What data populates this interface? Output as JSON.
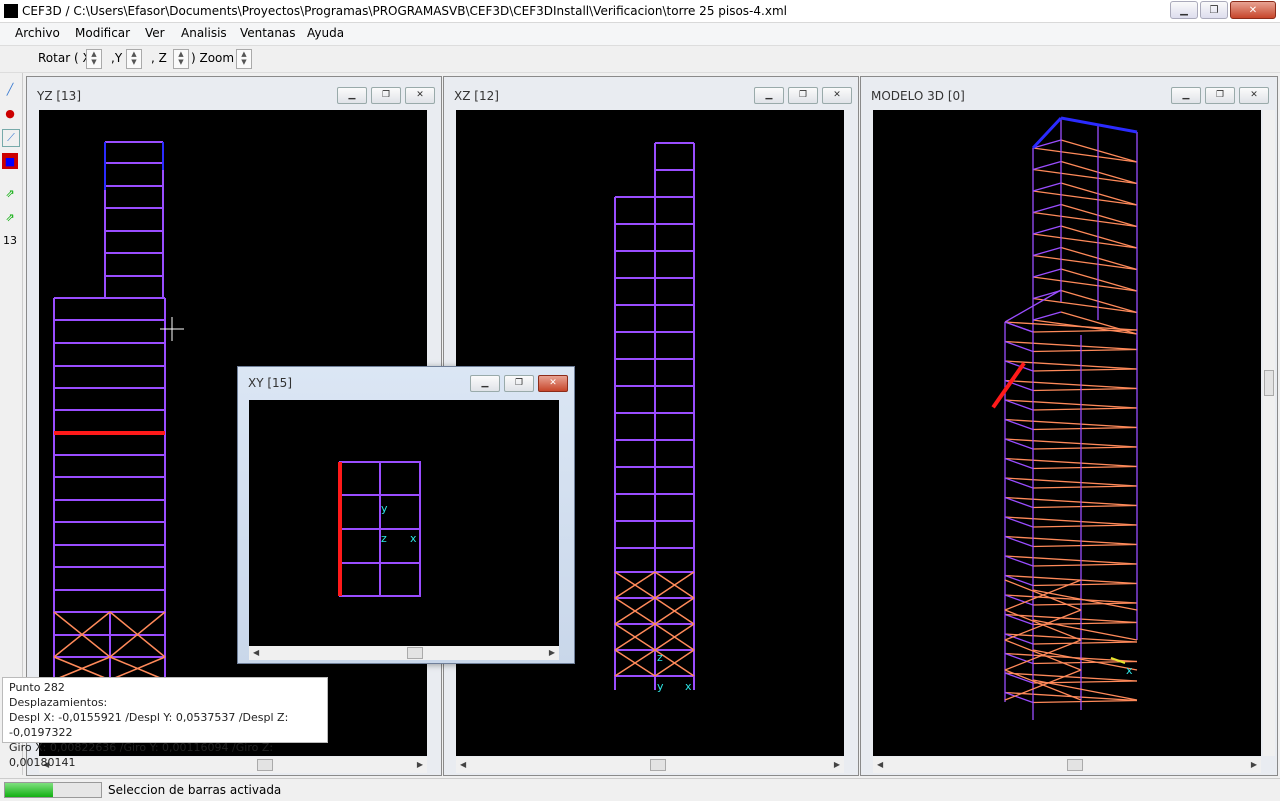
{
  "app": {
    "title": "CEF3D / C:\\Users\\Efasor\\Documents\\Proyectos\\Programas\\PROGRAMASVB\\CEF3D\\CEF3DInstall\\Verificacion\\torre 25 pisos-4.xml"
  },
  "menu": [
    "Archivo",
    "Modificar",
    "Ver",
    "Analisis",
    "Ventanas",
    "Ayuda"
  ],
  "toolbar": {
    "rotar_label": "Rotar ( X",
    "y_label": ",Y",
    "z_label": ", Z",
    "zoom_label": ") Zoom"
  },
  "left_tools": {
    "number": "13"
  },
  "windows": {
    "yz": {
      "title": "YZ [13]"
    },
    "xz": {
      "title": "XZ [12]"
    },
    "modelo": {
      "title": "MODELO 3D [0]"
    },
    "xy": {
      "title": "XY [15]"
    }
  },
  "axis_labels": {
    "x": "x",
    "y": "y",
    "z": "z"
  },
  "tooltip": {
    "line1": "Punto 282",
    "line2": "Desplazamientos:",
    "line3": "Despl X: -0,0155921 /Despl Y: 0,0537537 /Despl Z: -0,0197322",
    "line4": "Giro X: 0,00822636 /Giro Y: 0,00116094 /Giro Z: 0,00180141"
  },
  "status": {
    "text": "Seleccion de barras activada",
    "progress_percent": 50
  },
  "colors": {
    "bar_purple": "#9a4dff",
    "bar_orange": "#ff8a5a",
    "bar_selected": "#ff1a1a",
    "bar_top": "#2b2bff",
    "axis": "#2ee6e6"
  }
}
